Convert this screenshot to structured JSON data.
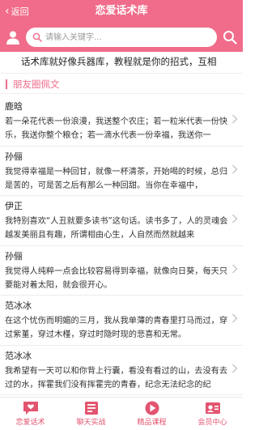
{
  "header": {
    "back_label": "返回",
    "title": "恋爱话术库"
  },
  "search": {
    "placeholder": "请输入关键字..."
  },
  "notice": "话术库就好像兵器库，教程就是你的招式，互相",
  "section": {
    "title": "朋友圈佩文"
  },
  "items": [
    {
      "author": "鹿晗",
      "text": "若一朵花代表一份浪漫，我送整个农庄；若一粒米代表一份快乐，我送你整个粮仓；若一滴水代表一份幸福，我送你一"
    },
    {
      "author": "孙俪",
      "text": "我觉得幸福是一种回甘，就像一杯清茶，开始喝的时候，总归是苦的，可是苦之后有那么一种回甜。当你在幸福中，"
    },
    {
      "author": "伊正",
      "text": "我特别喜欢“人丑就要多读书”这句话。读书多了，人的灵魂会越发美丽且有趣，所谓相由心生，人自然而然就越来"
    },
    {
      "author": "孙俪",
      "text": "我觉得人纯粹一点会比较容易得到幸福，就像向日葵，每天只要能对着太阳，就会很开心。"
    },
    {
      "author": "范冰冰",
      "text": "在这个忧伤而明媚的三月，我从我单薄的青春里打马而过，穿过紫堇，穿过木槿，穿过时隐时现的悲喜和无常。"
    },
    {
      "author": "范冰冰",
      "text": "我希望有一天可以和你背上行囊，看没有看过的山，去没有去过的水，挥霍我们没有挥霍完的青春，纪念无法纪念的纪"
    }
  ],
  "tabs": [
    {
      "label": "恋爱话术",
      "icon": "chat-heart-icon"
    },
    {
      "label": "聊天实战",
      "icon": "book-icon"
    },
    {
      "label": "精品课程",
      "icon": "course-icon"
    },
    {
      "label": "会员中心",
      "icon": "member-icon"
    }
  ],
  "colors": {
    "brand": "#f06c8a",
    "tab_label": "#e2546f"
  }
}
